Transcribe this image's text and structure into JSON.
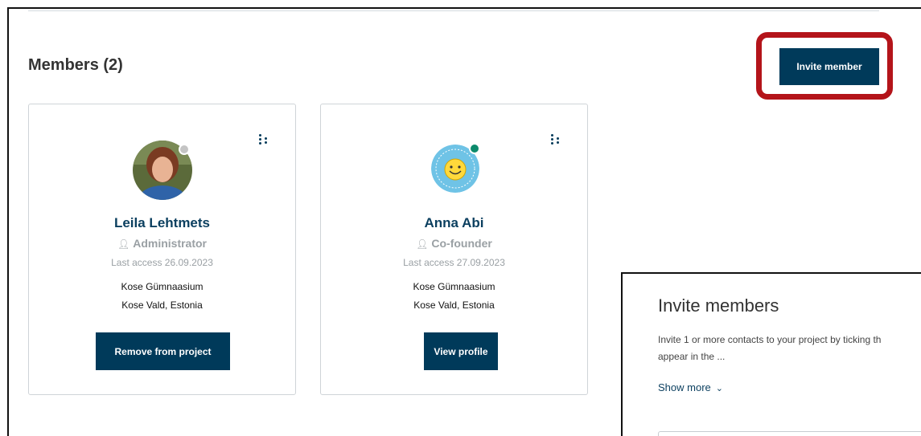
{
  "section": {
    "title": "Members (2)"
  },
  "toolbar": {
    "invite_label": "Invite member"
  },
  "members": [
    {
      "name": "Leila Lehtmets",
      "role": "Administrator",
      "last_access": "Last access 26.09.2023",
      "school": "Kose Gümnaasium",
      "location": "Kose Vald, Estonia",
      "action": "Remove from project",
      "status": "offline"
    },
    {
      "name": "Anna Abi",
      "role": "Co-founder",
      "last_access": "Last access 27.09.2023",
      "school": "Kose Gümnaasium",
      "location": "Kose Vald, Estonia",
      "action": "View profile",
      "status": "online"
    }
  ],
  "invite_panel": {
    "title": "Invite members",
    "description_line1": "Invite 1 or more contacts to your project by ticking th",
    "description_line2": "appear in the ...",
    "show_more": "Show more"
  },
  "colors": {
    "primary": "#003a5a",
    "highlight": "#b4141a",
    "online": "#0c8a6c",
    "offline": "#c4c4c4"
  },
  "icons": {
    "role": "person-icon",
    "menu": "kebab-menu-icon",
    "expand": "chevron-down-icon"
  }
}
